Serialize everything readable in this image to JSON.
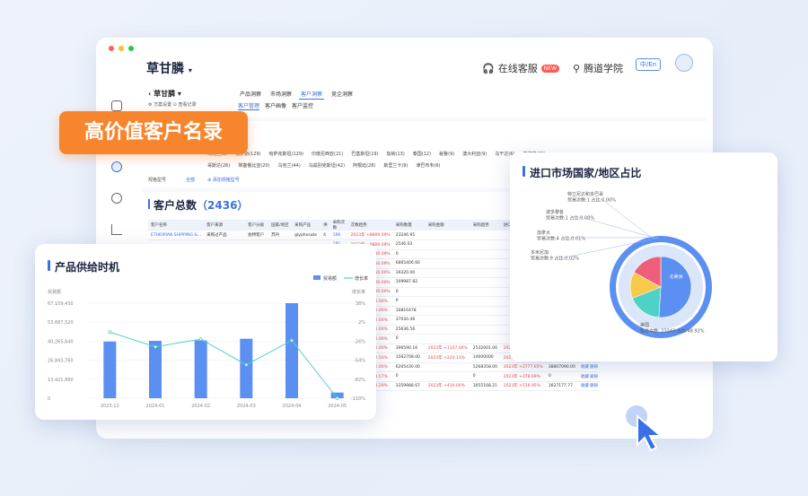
{
  "header": {
    "brand": "草甘膦",
    "service": "在线客服",
    "new_badge": "NEW",
    "academy": "腾道学院",
    "lang": "中/En"
  },
  "subnav": {
    "crumb": "草甘膦",
    "tabs": [
      "产品洞察",
      "市场洞察",
      "客户洞察",
      "竞企洞察"
    ],
    "active_tab": 2,
    "tabs2": [
      "客户管理",
      "客户画像",
      "客户监控"
    ],
    "links": [
      "方案设置",
      "查看记录"
    ],
    "filter_label": "规格型号",
    "filter_all": "全部",
    "filter_add": "添加规格型号"
  },
  "countries": [
    "乌克兰(3)",
    "俄罗斯(129)",
    "哈萨克斯坦(129)",
    "印度尼西亚(21)",
    "巴基斯坦(19)",
    "加纳(13)",
    "泰国(12)",
    "秘鲁(9)",
    "澳大利亚(9)",
    "乌干达(6)",
    "菲律宾(28)",
    "哥斯达(26)",
    "埃塞俄比亚(20)",
    "乌克兰(44)",
    "乌兹别克斯坦(42)",
    "阿根廷(28)",
    "斯里兰卡(9)",
    "津巴布韦(6)"
  ],
  "label": "高价值客户名录",
  "total": {
    "label": "客户总数",
    "count": "（2436）"
  },
  "table": {
    "headers": [
      "客户名称",
      "客户来源",
      "客户分级",
      "国家/地区",
      "采购产品",
      "供",
      "采购次数",
      "次数趋势",
      "采购数量",
      "采购金额",
      "采购趋势",
      "进口量",
      "采购占比",
      "操作"
    ],
    "rows": [
      [
        "ETHIOPIAN SHIPPING &...",
        "采购过产品",
        "伯特客户",
        "苏丹",
        "glyphosate",
        "4",
        "196",
        "2023年 +8809.09%",
        "23246.95",
        "",
        "",
        "",
        "",
        ""
      ],
      [
        "",
        "",
        "",
        "",
        "",
        "",
        "181",
        "2023年 +8809.09%",
        "2546.03",
        "",
        "",
        "",
        "",
        ""
      ],
      [
        "",
        "",
        "",
        "",
        "",
        "",
        "90",
        "2023年 +2030.09%",
        "0",
        "",
        "",
        "",
        "",
        ""
      ],
      [
        "",
        "",
        "",
        "",
        "",
        "",
        "31",
        "2023年 +1250.09%",
        "6865406.60",
        "",
        "",
        "",
        "",
        ""
      ],
      [
        "",
        "",
        "",
        "",
        "",
        "",
        "20",
        "2023年 +1250.00%",
        "39320.00",
        "",
        "",
        "",
        "",
        ""
      ],
      [
        "",
        "",
        "",
        "",
        "",
        "",
        "17",
        "2023年 +1100.00%",
        "109987.82",
        "",
        "",
        "",
        "",
        ""
      ],
      [
        "",
        "",
        "",
        "",
        "",
        "",
        "12",
        "2023年 +1000.00%",
        "0",
        "",
        "",
        "",
        "",
        ""
      ],
      [
        "",
        "",
        "",
        "",
        "",
        "",
        "12",
        "2023年 +800.00%",
        "0",
        "",
        "",
        "",
        "",
        ""
      ],
      [
        "",
        "",
        "",
        "",
        "",
        "",
        "13",
        "2023年 +700.00%",
        "10816478",
        "",
        "",
        "",
        "",
        ""
      ],
      [
        "",
        "",
        "",
        "",
        "",
        "",
        "13",
        "2023年 +700.00%",
        "37030.46",
        "",
        "",
        "",
        "",
        ""
      ],
      [
        "",
        "",
        "",
        "",
        "",
        "",
        "13",
        "2023年 +600.00%",
        "25636.56",
        "",
        "",
        "",
        "",
        ""
      ],
      [
        "",
        "",
        "",
        "",
        "",
        "",
        "11",
        "2023年 +600.00%",
        "0",
        "",
        "",
        "",
        "",
        ""
      ],
      [
        "",
        "",
        "",
        "",
        "",
        "",
        "8",
        "2023年 +600.00%",
        "396590.16",
        "2023年 +1107.06%",
        "2532001.00",
        "2023年 +152.26%",
        "1615623.77",
        "收藏 删除"
      ],
      [
        "",
        "",
        "",
        "",
        "",
        "",
        "29",
        "2023年 +562.50%",
        "1562708.00",
        "2023年 +224.13%",
        "14000000",
        "2023年 +385.98%",
        "12623825.75",
        "收藏 删除"
      ],
      [
        "",
        "",
        "",
        "",
        "",
        "",
        "19",
        "2023年 +550.00%",
        "6205430.00",
        "",
        "5268358.00",
        "2023年 +2777.65%",
        "38807090.00",
        "收藏 删除"
      ],
      [
        "",
        "",
        "",
        "",
        "",
        "",
        "56",
        "2023年 +528.57%",
        "0",
        "",
        "0",
        "2023年 +378.69%",
        "0",
        "收藏 删除"
      ],
      [
        "",
        "",
        "",
        "",
        "",
        "",
        "23",
        "2023年 +514.29%",
        "3359988.67",
        "2023年 +434.00%",
        "3055168.21",
        "2023年 +516.95%",
        "1627177.77",
        "收藏 删除"
      ]
    ]
  },
  "supply_card": {
    "title": "产品供给时机",
    "legend_bar": "贸易额",
    "legend_line": "增长率",
    "left_axis_title": "贸易额",
    "right_axis_title": "增长率",
    "left_ticks": [
      "67,109,430",
      "53,687,520",
      "40,265,640",
      "26,843,760",
      "13,421,880",
      "0"
    ],
    "right_ticks": [
      "38%",
      "2%",
      "-26%",
      "-54%",
      "-82%",
      "-110%"
    ]
  },
  "pie_card": {
    "title": "进口市场国家/地区占比",
    "center_label": "北美洲",
    "annotations": [
      {
        "name": "特立尼达和多巴哥",
        "detail": "贸易次数:1 占比:0.00%"
      },
      {
        "name": "波多黎各",
        "detail": "贸易次数:1 占比:0.00%"
      },
      {
        "name": "加拿大",
        "detail": "贸易次数:4 占比:0.01%"
      },
      {
        "name": "多米尼加",
        "detail": "贸易次数:9 占比:0.02%"
      },
      {
        "name": "美国",
        "detail": "贸易次数: 23243 占比:48.92%"
      }
    ]
  },
  "chart_data": [
    {
      "type": "bar",
      "title": "产品供给时机",
      "categories": [
        "2023-12",
        "2024-01",
        "2024-02",
        "2024-03",
        "2024-04",
        "2024-05"
      ],
      "series": [
        {
          "name": "贸易额",
          "type": "bar",
          "values": [
            40000000,
            40500000,
            40800000,
            42000000,
            67100000,
            4000000
          ],
          "axis": "left"
        },
        {
          "name": "增长率",
          "type": "line",
          "values": [
            -7,
            -30,
            -18,
            -58,
            -20,
            -110
          ],
          "axis": "right"
        }
      ],
      "ylim": [
        0,
        67109430
      ],
      "y2lim": [
        -110,
        38
      ],
      "colors": {
        "bar": "#5b8ff2",
        "line": "#4fd1c5"
      }
    },
    {
      "type": "pie",
      "title": "进口市场国家/地区占比",
      "slices": [
        {
          "label": "北美洲",
          "value": 51,
          "color": "#5b8ff2"
        },
        {
          "label": "",
          "value": 18,
          "color": "#4fd1c5"
        },
        {
          "label": "",
          "value": 14,
          "color": "#f8c94a"
        },
        {
          "label": "",
          "value": 17,
          "color": "#ef5e7a"
        }
      ]
    }
  ]
}
